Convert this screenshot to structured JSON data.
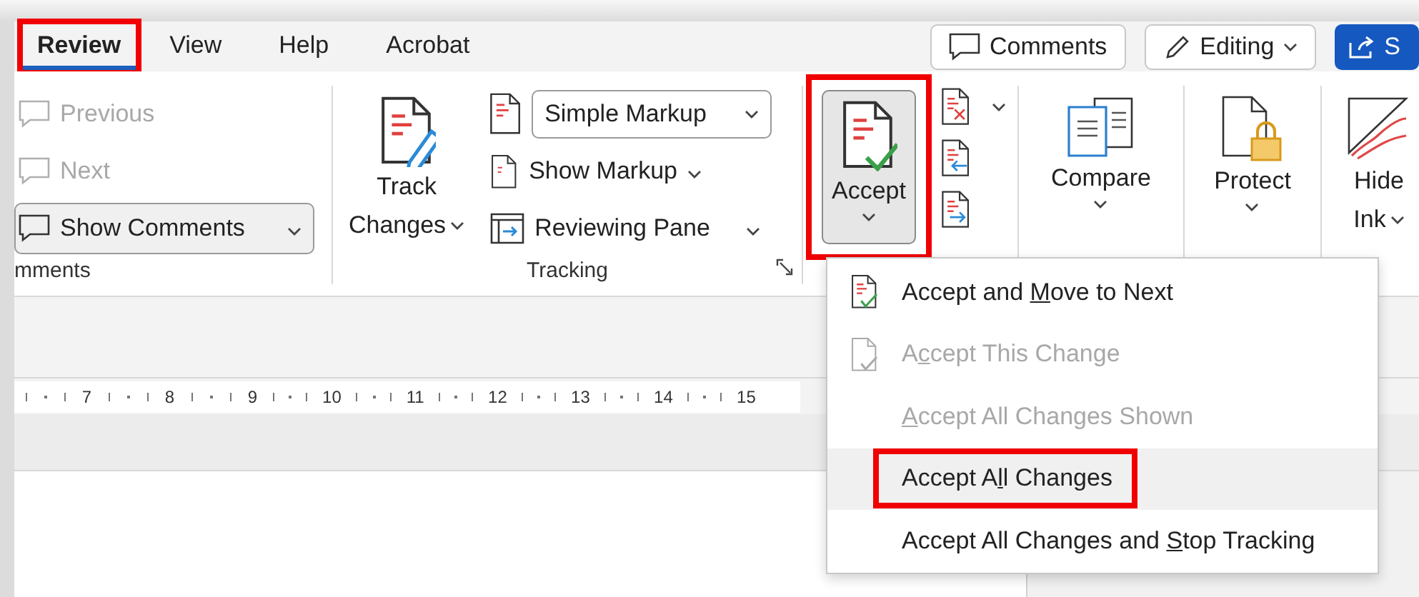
{
  "tabs": [
    {
      "label": "Review",
      "selected": true,
      "highlighted": true
    },
    {
      "label": "View",
      "selected": false,
      "highlighted": false
    },
    {
      "label": "Help",
      "selected": false,
      "highlighted": false
    },
    {
      "label": "Acrobat",
      "selected": false,
      "highlighted": false
    }
  ],
  "header_buttons": [
    {
      "kind": "comments",
      "label": "Comments"
    },
    {
      "kind": "editing",
      "label": "Editing"
    },
    {
      "kind": "share",
      "label": "S"
    }
  ],
  "comments_group": {
    "label": "mments",
    "items": [
      {
        "kind": "nav",
        "label": "Previous",
        "disabled": true,
        "on": false
      },
      {
        "kind": "nav",
        "label": "Next",
        "disabled": true,
        "on": false
      },
      {
        "kind": "toggle",
        "label": "Show Comments",
        "disabled": false,
        "on": true
      }
    ]
  },
  "tracking_group": {
    "label": "Tracking",
    "track_changes": {
      "line1": "Track",
      "line2": "Changes"
    },
    "markup_select": {
      "value": "Simple Markup"
    },
    "items": [
      {
        "kind": "markup",
        "label": "Show Markup"
      },
      {
        "kind": "pane",
        "label": "Reviewing Pane"
      }
    ]
  },
  "changes_group": {
    "accept": {
      "label": "Accept",
      "pressed": true,
      "highlighted": true
    }
  },
  "big_buttons": [
    {
      "kind": "compare",
      "label": "Compare"
    },
    {
      "kind": "protect",
      "label": "Protect"
    },
    {
      "kind": "ink",
      "label": "Hide",
      "label2": "Ink"
    }
  ],
  "ruler": [
    "7",
    "8",
    "9",
    "10",
    "11",
    "12",
    "13",
    "14",
    "15"
  ],
  "accept_menu": [
    {
      "before": "Accept and ",
      "key": "M",
      "after": "ove to Next",
      "icon": true,
      "disabled": false,
      "hovered": false,
      "highlighted": false
    },
    {
      "before": "A",
      "key": "c",
      "after": "cept This Change",
      "icon": true,
      "disabled": true,
      "hovered": false,
      "highlighted": false
    },
    {
      "key": "A",
      "after": "ccept All Changes Shown",
      "icon": false,
      "disabled": true,
      "hovered": false,
      "highlighted": false
    },
    {
      "before": "Accept A",
      "key": "l",
      "after": "l Changes",
      "icon": false,
      "disabled": false,
      "hovered": true,
      "highlighted": true
    },
    {
      "before": "Accept All Changes and ",
      "key": "S",
      "after": "top Tracking",
      "icon": false,
      "disabled": false,
      "hovered": false,
      "highlighted": false
    }
  ]
}
